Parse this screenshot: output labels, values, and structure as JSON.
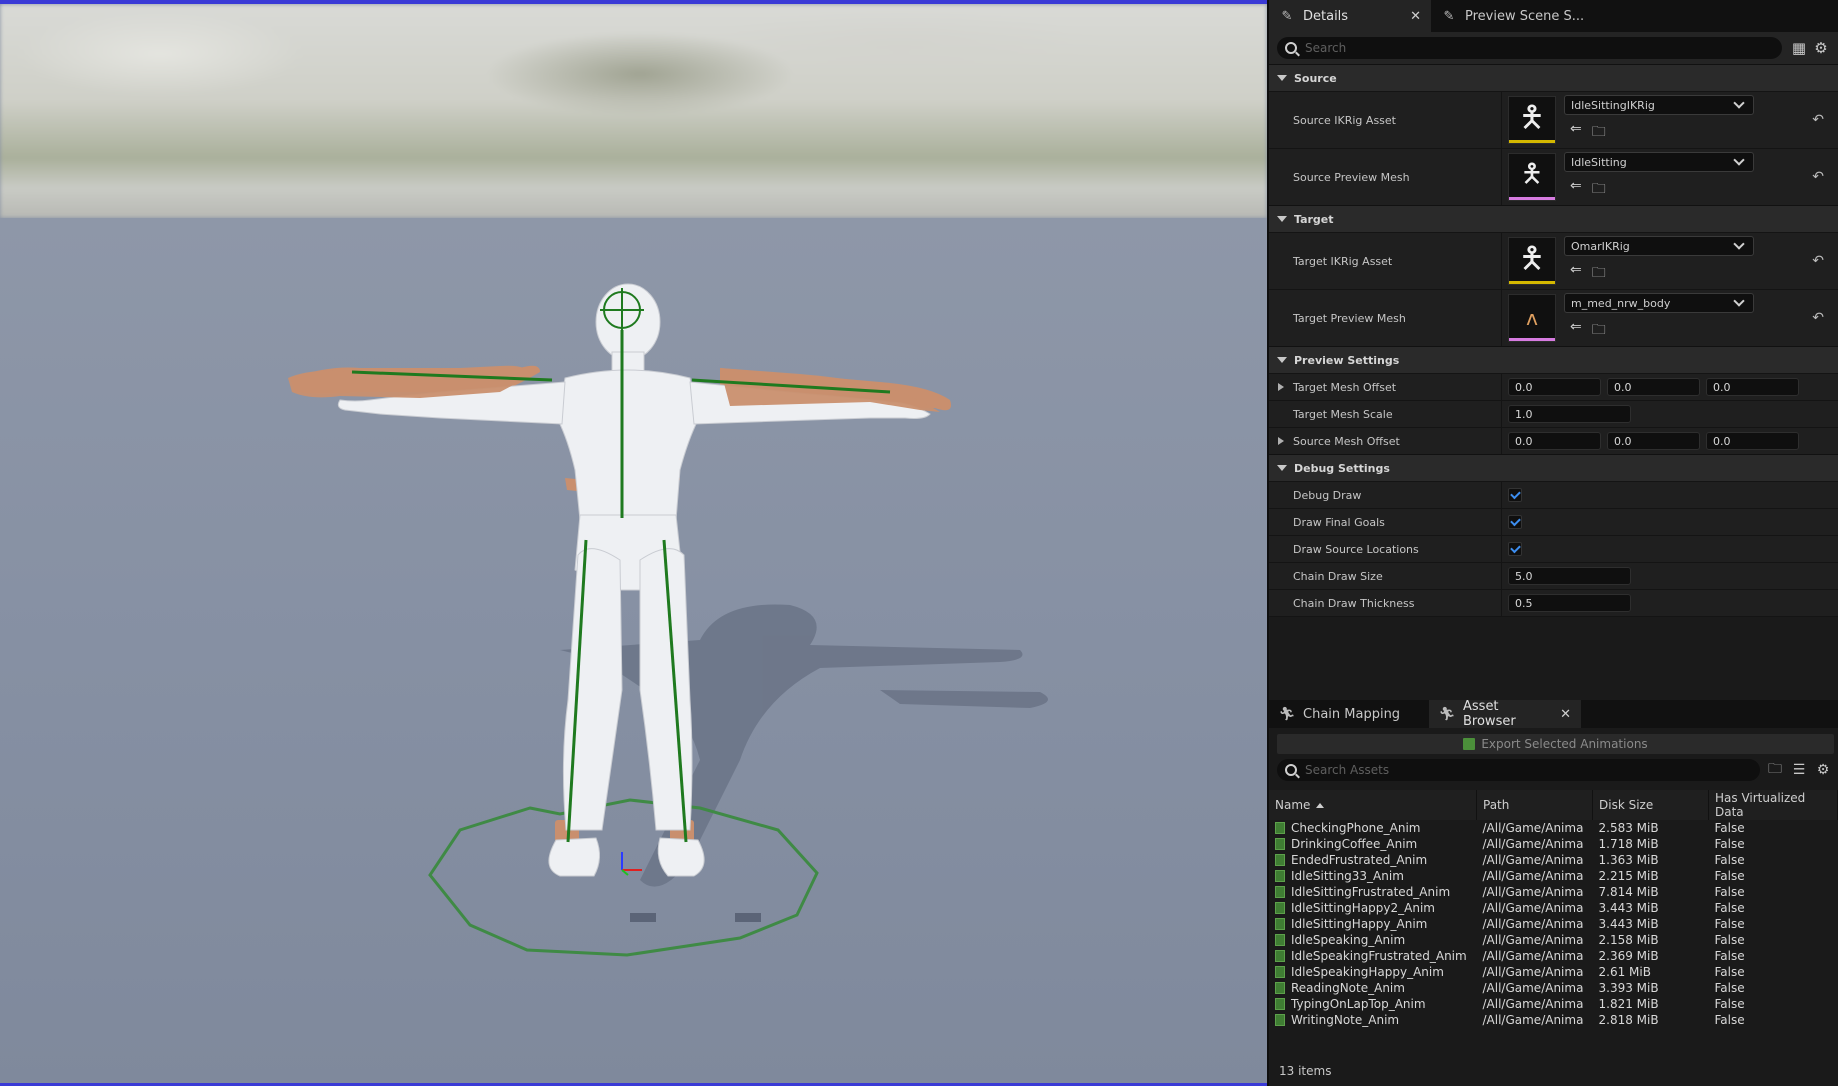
{
  "details_panel": {
    "tabs": [
      {
        "label": "Details",
        "icon": "pencil-icon",
        "closable": true
      },
      {
        "label": "Preview Scene S...",
        "icon": "pencil-icon",
        "closable": false
      }
    ],
    "search": {
      "placeholder": "Search",
      "value": ""
    },
    "sections": {
      "source": {
        "title": "Source",
        "ikrig": {
          "label": "Source IKRig Asset",
          "value": "IdleSittingIKRig",
          "bar_color": "#d4b800"
        },
        "mesh": {
          "label": "Source Preview Mesh",
          "value": "IdleSitting",
          "bar_color": "#d67be0"
        }
      },
      "target": {
        "title": "Target",
        "ikrig": {
          "label": "Target IKRig Asset",
          "value": "OmarIKRig",
          "bar_color": "#d4b800"
        },
        "mesh": {
          "label": "Target Preview Mesh",
          "value": "m_med_nrw_body",
          "bar_color": "#d67be0"
        }
      },
      "preview": {
        "title": "Preview Settings",
        "target_mesh_offset": {
          "label": "Target Mesh Offset",
          "x": "0.0",
          "y": "0.0",
          "z": "0.0"
        },
        "target_mesh_scale": {
          "label": "Target Mesh Scale",
          "value": "1.0"
        },
        "source_mesh_offset": {
          "label": "Source Mesh Offset",
          "x": "0.0",
          "y": "0.0",
          "z": "0.0"
        }
      },
      "debug": {
        "title": "Debug Settings",
        "debug_draw": {
          "label": "Debug Draw",
          "checked": true
        },
        "draw_final_goals": {
          "label": "Draw Final Goals",
          "checked": true
        },
        "draw_source_locations": {
          "label": "Draw Source Locations",
          "checked": true
        },
        "chain_draw_size": {
          "label": "Chain Draw Size",
          "value": "5.0"
        },
        "chain_draw_thickness": {
          "label": "Chain Draw Thickness",
          "value": "0.5"
        }
      }
    }
  },
  "asset_browser": {
    "tabs": [
      {
        "label": "Chain Mapping",
        "icon": "running-figure-icon"
      },
      {
        "label": "Asset Browser",
        "icon": "running-figure-icon",
        "closable": true
      }
    ],
    "export_button": "Export Selected Animations",
    "search": {
      "placeholder": "Search Assets",
      "value": ""
    },
    "columns": [
      "Name",
      "Path",
      "Disk Size",
      "Has Virtualized Data"
    ],
    "rows": [
      {
        "name": "CheckingPhone_Anim",
        "path": "/All/Game/Anima",
        "size": "2.583 MiB",
        "virtualized": "False"
      },
      {
        "name": "DrinkingCoffee_Anim",
        "path": "/All/Game/Anima",
        "size": "1.718 MiB",
        "virtualized": "False"
      },
      {
        "name": "EndedFrustrated_Anim",
        "path": "/All/Game/Anima",
        "size": "1.363 MiB",
        "virtualized": "False"
      },
      {
        "name": "IdleSitting33_Anim",
        "path": "/All/Game/Anima",
        "size": "2.215 MiB",
        "virtualized": "False"
      },
      {
        "name": "IdleSittingFrustrated_Anim",
        "path": "/All/Game/Anima",
        "size": "7.814 MiB",
        "virtualized": "False"
      },
      {
        "name": "IdleSittingHappy2_Anim",
        "path": "/All/Game/Anima",
        "size": "3.443 MiB",
        "virtualized": "False"
      },
      {
        "name": "IdleSittingHappy_Anim",
        "path": "/All/Game/Anima",
        "size": "3.443 MiB",
        "virtualized": "False"
      },
      {
        "name": "IdleSpeaking_Anim",
        "path": "/All/Game/Anima",
        "size": "2.158 MiB",
        "virtualized": "False"
      },
      {
        "name": "IdleSpeakingFrustrated_Anim",
        "path": "/All/Game/Anima",
        "size": "2.369 MiB",
        "virtualized": "False"
      },
      {
        "name": "IdleSpeakingHappy_Anim",
        "path": "/All/Game/Anima",
        "size": "2.61 MiB",
        "virtualized": "False"
      },
      {
        "name": "ReadingNote_Anim",
        "path": "/All/Game/Anima",
        "size": "3.393 MiB",
        "virtualized": "False"
      },
      {
        "name": "TypingOnLapTop_Anim",
        "path": "/All/Game/Anima",
        "size": "1.821 MiB",
        "virtualized": "False"
      },
      {
        "name": "WritingNote_Anim",
        "path": "/All/Game/Anima",
        "size": "2.818 MiB",
        "virtualized": "False"
      }
    ],
    "item_count": "13 items"
  },
  "colors": {
    "bone_green": "#1f7a1f",
    "circle_green": "#3f8a45",
    "skin": "#c98f6e",
    "mannequin": "#eef0f3",
    "checkbox_blue": "#3d8ef0"
  }
}
